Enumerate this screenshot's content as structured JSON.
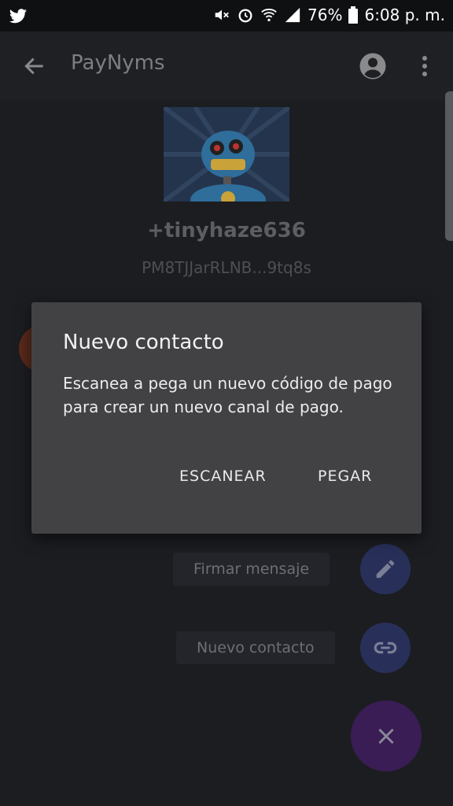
{
  "status_bar": {
    "battery_percent": "76%",
    "time": "6:08 p. m."
  },
  "app_bar": {
    "title": "PayNyms"
  },
  "profile": {
    "handle": "+tinyhaze636",
    "payment_code": "PM8TJJarRLNB...9tq8s"
  },
  "dialog": {
    "title": "Nuevo contacto",
    "message": "Escanea a pega un nuevo código de pago para crear un nuevo canal de pago.",
    "scan_label": "ESCANEAR",
    "paste_label": "PEGAR"
  },
  "fab_menu": {
    "sign_message_label": "Firmar mensaje",
    "new_contact_label": "Nuevo contacto",
    "close_symbol": "×"
  },
  "colors": {
    "dialog_bg": "#424245",
    "fab_primary": "#3a1d55",
    "fab_secondary": "#28305a",
    "appbar_bg": "#1f2024"
  }
}
